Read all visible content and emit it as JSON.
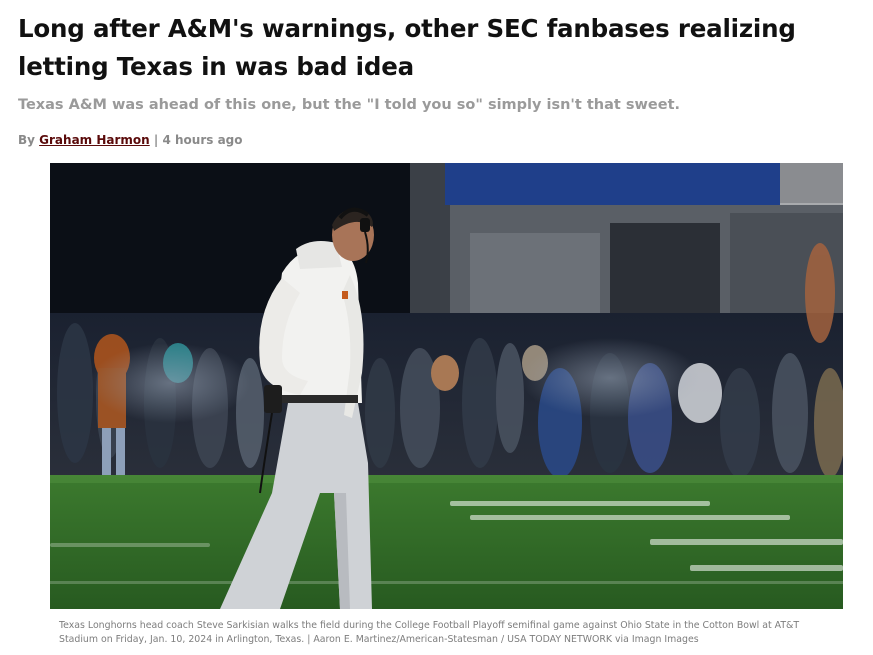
{
  "article": {
    "headline": "Long after A&M's warnings, other SEC fanbases realizing letting Texas in was bad idea",
    "subheadline": "Texas A&M was ahead of this one, but the \"I told you so\" simply isn't that sweet.",
    "byline_prefix": "By",
    "author": "Graham Harmon",
    "separator": "|",
    "timestamp": "4 hours ago"
  },
  "photo": {
    "caption": "Texas Longhorns head coach Steve Sarkisian walks the field during the College Football Playoff semifinal game against Ohio State in the Cotton Bowl at AT&T Stadium on Friday, Jan. 10, 2024 in Arlington, Texas. | Aaron E. Martinez/American-Statesman / USA TODAY NETWORK via Imagn Images"
  },
  "colors": {
    "author_link": "#5a0a0a",
    "subhead_gray": "#9a9a9a",
    "field_green": "#2f6b27"
  }
}
